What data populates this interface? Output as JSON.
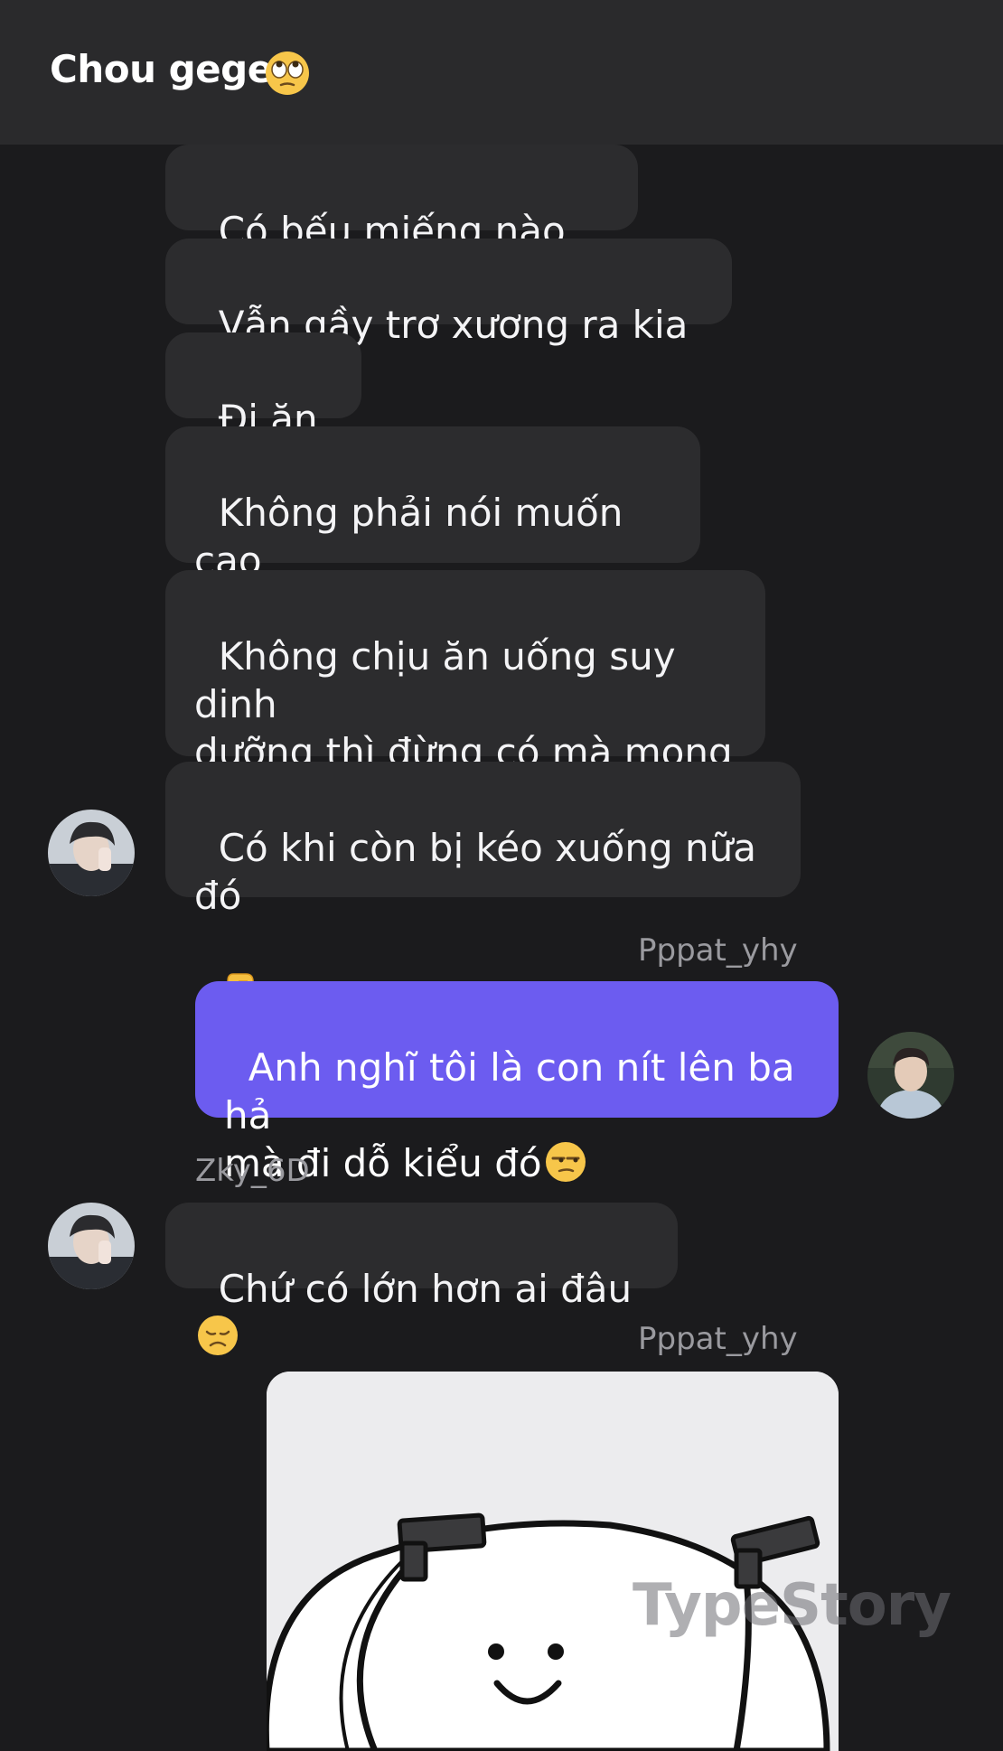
{
  "header": {
    "title": "Chou gege",
    "title_emoji": "face-with-rolling-eyes-icon"
  },
  "messages": [
    {
      "sender": "other",
      "text": "Có bếu miếng nào đâu"
    },
    {
      "sender": "other",
      "text": "Vẫn gầy trơ xương ra kia mà"
    },
    {
      "sender": "other",
      "text": "Đi ăn đi"
    },
    {
      "sender": "other",
      "text": "Không phải nói muốn cao\nthêm à"
    },
    {
      "sender": "other",
      "text": "Không chịu ăn uống suy dinh\ndưỡng thì đừng có mà mong\ncao lên được"
    },
    {
      "sender": "other",
      "text": "Có khi còn bị kéo xuống nữa đó",
      "emoji": "pointing-down-hand-icon"
    },
    {
      "sender": "me",
      "username": "Pppat_yhy",
      "text": "Anh nghĩ tôi là con nít lên ba hả\nmà đi dỗ kiểu đó",
      "emoji": "unamused-face-icon"
    },
    {
      "sender": "other",
      "username": "Zky_6D",
      "text": "Chứ có lớn hơn ai đâu",
      "emoji": "disappointed-face-icon"
    },
    {
      "sender": "me",
      "username": "Pppat_yhy",
      "type": "sticker",
      "sticker": "smiling-blob-with-guns-sticker"
    }
  ],
  "watermark": "TypeStory",
  "colors": {
    "background": "#1b1b1d",
    "header": "#2a2a2c",
    "incoming_bubble": "#2c2c2e",
    "outgoing_bubble": "#6c5cf0",
    "username": "#9a9a9f"
  }
}
